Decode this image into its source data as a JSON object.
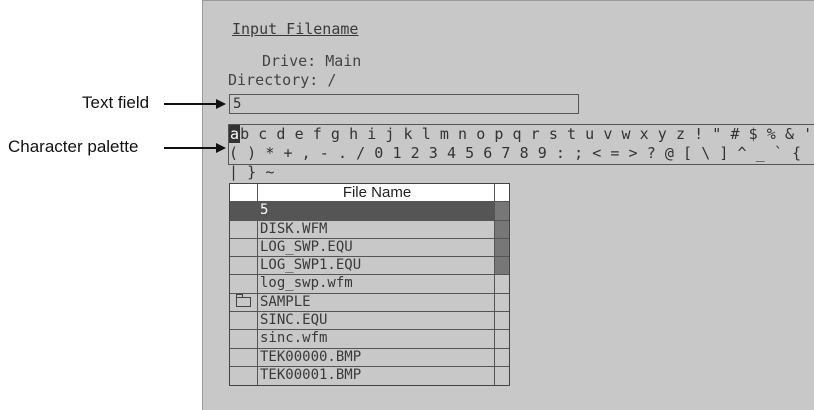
{
  "dialog": {
    "title": "Input Filename",
    "drive": "Drive: Main",
    "directory": "Directory: /",
    "text_field_value": "5"
  },
  "callouts": {
    "text_field": "Text field",
    "character_palette": "Character palette"
  },
  "palette": {
    "selected_char": "a",
    "line1_rest": "b c d e f g h i j k l m n o p q r s t u v w x y z   ! \" # $ % & '",
    "line2": "( ) * + , - . / 0 1 2 3 4 5 6 7 8 9 : ; < = > ? @ [ \\ ] ^ _ ` { | } ~"
  },
  "file_table": {
    "header": "File Name",
    "rows": [
      {
        "name": "5",
        "selected": true,
        "icon": ""
      },
      {
        "name": "DISK.WFM",
        "icon": ""
      },
      {
        "name": "LOG_SWP.EQU",
        "icon": ""
      },
      {
        "name": "LOG_SWP1.EQU",
        "icon": ""
      },
      {
        "name": "log_swp.wfm",
        "icon": ""
      },
      {
        "name": "SAMPLE",
        "icon": "folder-icon"
      },
      {
        "name": "SINC.EQU",
        "icon": ""
      },
      {
        "name": "sinc.wfm",
        "icon": ""
      },
      {
        "name": "TEK00000.BMP",
        "icon": ""
      },
      {
        "name": "TEK00001.BMP",
        "icon": ""
      }
    ]
  },
  "colors": {
    "panel_bg": "#c8c8c8",
    "selection": "#555555"
  }
}
